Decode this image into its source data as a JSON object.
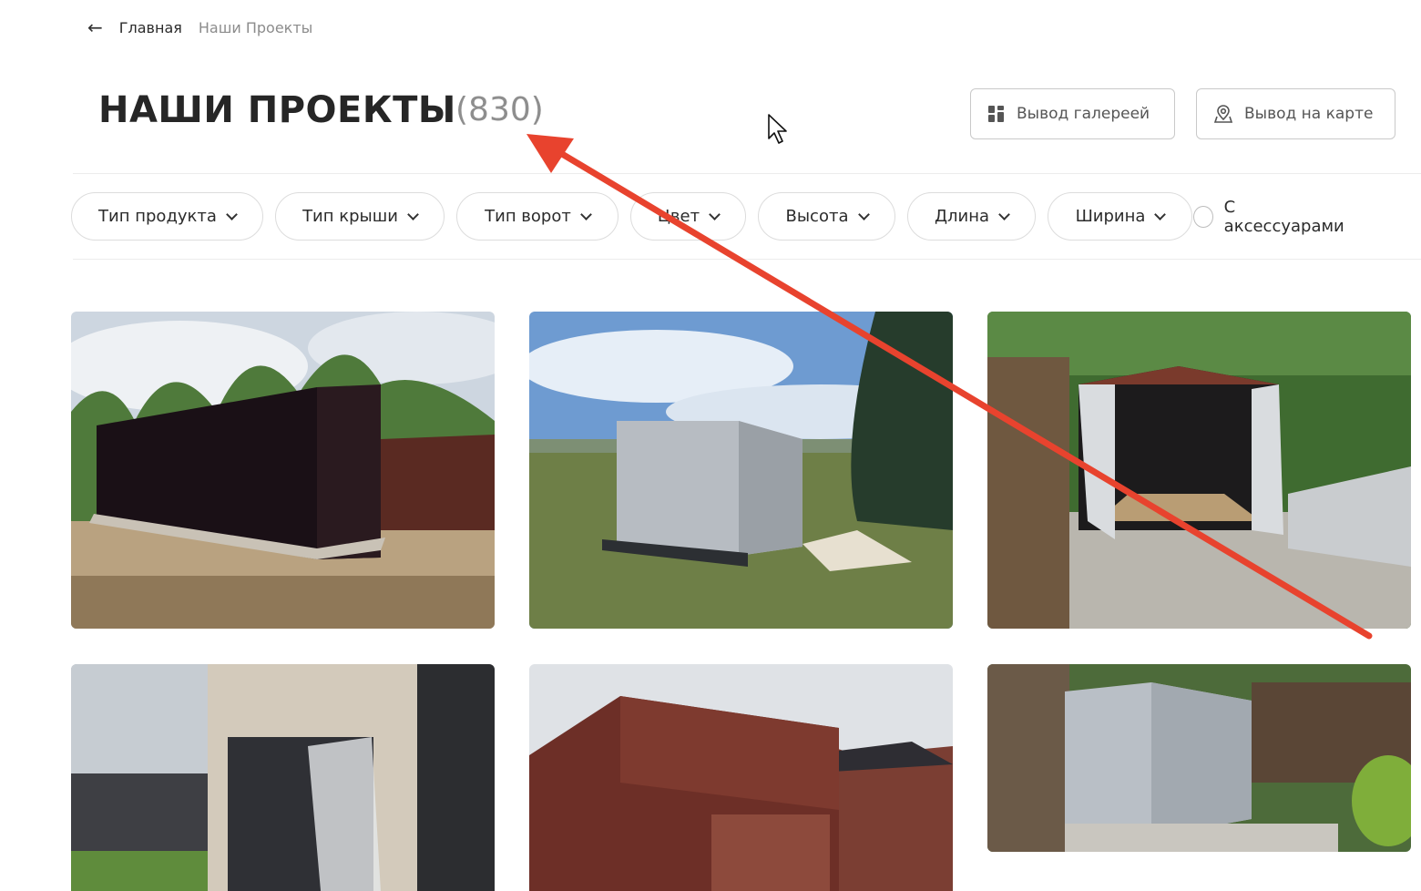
{
  "breadcrumb": {
    "back_icon": "arrow-left-icon",
    "home": "Главная",
    "current": "Наши Проекты"
  },
  "header": {
    "title": "НАШИ ПРОЕКТЫ",
    "count": "(830)"
  },
  "view_buttons": {
    "gallery": "Вывод галереей",
    "map": "Вывод на карте"
  },
  "filters": [
    "Тип продукта",
    "Тип крыши",
    "Тип ворот",
    "Цвет",
    "Высота",
    "Длина",
    "Ширина"
  ],
  "accessories_label": "С аксессуарами",
  "colors": {
    "accent_arrow": "#e8432e",
    "text": "#262626",
    "muted": "#8e8e8e"
  }
}
